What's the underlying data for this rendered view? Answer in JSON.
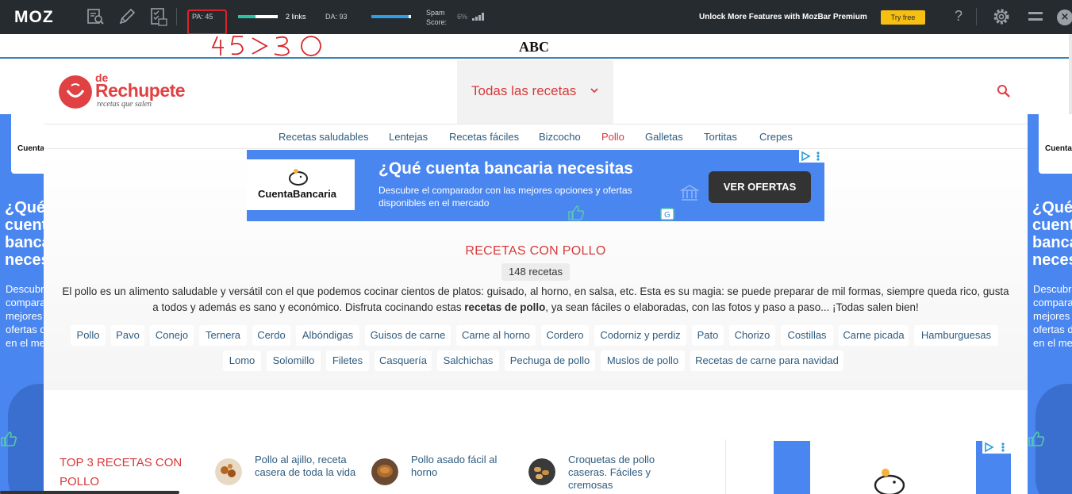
{
  "mozbar": {
    "logo": "MOZ",
    "pa": "PA: 45",
    "links": "2 links",
    "da": "DA: 93",
    "spam_label_1": "Spam",
    "spam_label_2": "Score:",
    "spam_value": "6%",
    "promo": "Unlock More Features with MozBar Premium",
    "try_free": "Try free",
    "help": "?",
    "close": "×",
    "colors": {
      "background": "#262b2f",
      "try_button": "#f7bf11",
      "annotation": "#d7262b"
    }
  },
  "annotation": {
    "text": "45>30"
  },
  "site_strip": {
    "label": "ABC"
  },
  "header": {
    "logo_de": "de",
    "logo_name": "Rechupete",
    "logo_sub": "recetas que salen",
    "nav_all": "Todas las recetas",
    "brand_color": "#e04143"
  },
  "subnav": {
    "items": [
      {
        "label": "Recetas saludables"
      },
      {
        "label": "Lentejas"
      },
      {
        "label": "Recetas fáciles"
      },
      {
        "label": "Bizcocho"
      },
      {
        "label": "Pollo"
      },
      {
        "label": "Galletas"
      },
      {
        "label": "Tortitas"
      },
      {
        "label": "Crepes"
      }
    ],
    "active": "Pollo"
  },
  "ad": {
    "brand": "CuentaBancaria",
    "headline": "¿Qué cuenta bancaria necesitas",
    "desc": "Descubre el comparador con las mejores opciones y ofertas disponibles en el mercado",
    "cta": "VER OFERTAS",
    "accent": "#4a86f0"
  },
  "side_ad": {
    "logo_text": "Cuenta",
    "big": "¿Qué cuenta banca neces",
    "small": "Descubre comparador con las mejores opciones y ofertas disponibles en el mercado"
  },
  "content": {
    "title": "RECETAS CON POLLO",
    "count": "148 recetas",
    "intro_before": "El pollo es un alimento saludable y versátil con el que podemos cocinar cientos de platos: guisado, al horno, en salsa, etc. Esta es su magia: se puede preparar de mil formas, siempre queda rico, gusta a todos y además es sano y económico. Disfruta cocinando estas ",
    "intro_bold": "recetas de pollo",
    "intro_after": ", ya sean fáciles o elaboradas, con las fotos y paso a paso... ¡Todas salen bien!",
    "tags_row1": [
      "Pollo",
      "Pavo",
      "Conejo",
      "Ternera",
      "Cerdo",
      "Albóndigas",
      "Guisos de carne",
      "Carne al horno",
      "Cordero",
      "Codorniz y perdiz",
      "Pato",
      "Chorizo",
      "Costillas",
      "Carne picada",
      "Hamburguesas"
    ],
    "tags_row2": [
      "Lomo",
      "Solomillo",
      "Filetes",
      "Casquería",
      "Salchichas",
      "Pechuga de pollo",
      "Muslos de pollo",
      "Recetas de carne para navidad"
    ]
  },
  "top3": {
    "title": "TOP 3 RECETAS CON POLLO",
    "items": [
      {
        "title": "Pollo al ajillo, receta casera de toda la vida"
      },
      {
        "title": "Pollo asado fácil al horno"
      },
      {
        "title": "Croquetas de pollo caseras. Fáciles y cremosas"
      }
    ]
  }
}
